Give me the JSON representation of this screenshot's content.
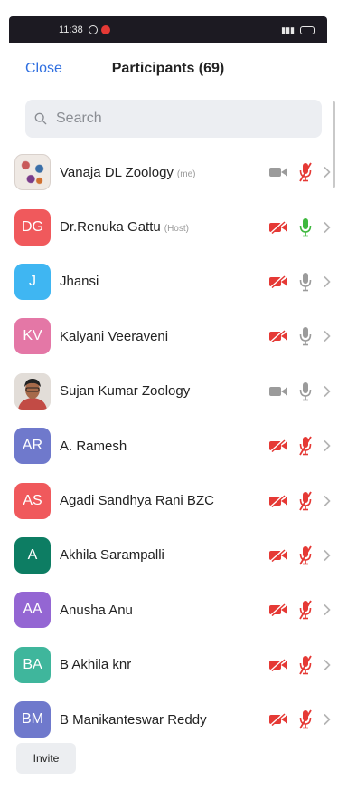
{
  "status_bar": {
    "time": "11:38"
  },
  "header": {
    "close_label": "Close",
    "title": "Participants (69)"
  },
  "search": {
    "placeholder": "Search"
  },
  "participants": [
    {
      "name": "Vanaja DL Zoology",
      "tag": "(me)",
      "avatar": {
        "type": "image",
        "icon": "art-photo"
      },
      "video": "off",
      "audio": "muted"
    },
    {
      "name": "Dr.Renuka Gattu",
      "tag": "(Host)",
      "avatar": {
        "type": "initials",
        "initials": "DG",
        "color": "#f0595c"
      },
      "video": "off-red",
      "audio": "active"
    },
    {
      "name": "Jhansi",
      "tag": "",
      "avatar": {
        "type": "initials",
        "initials": "J",
        "color": "#3fb6f2"
      },
      "video": "off-red",
      "audio": "unmuted"
    },
    {
      "name": "Kalyani Veeraveni",
      "tag": "",
      "avatar": {
        "type": "initials",
        "initials": "KV",
        "color": "#e477a6"
      },
      "video": "off-red",
      "audio": "unmuted"
    },
    {
      "name": "Sujan Kumar Zoology",
      "tag": "",
      "avatar": {
        "type": "image",
        "icon": "person-photo"
      },
      "video": "off",
      "audio": "unmuted"
    },
    {
      "name": "A. Ramesh",
      "tag": "",
      "avatar": {
        "type": "initials",
        "initials": "AR",
        "color": "#6f79cc"
      },
      "video": "off-red",
      "audio": "muted"
    },
    {
      "name": "Agadi Sandhya Rani BZC",
      "tag": "",
      "avatar": {
        "type": "initials",
        "initials": "AS",
        "color": "#f0595c"
      },
      "video": "off-red",
      "audio": "muted"
    },
    {
      "name": "Akhila Sarampalli",
      "tag": "",
      "avatar": {
        "type": "initials",
        "initials": "A",
        "color": "#0d7d63"
      },
      "video": "off-red",
      "audio": "muted"
    },
    {
      "name": "Anusha Anu",
      "tag": "",
      "avatar": {
        "type": "initials",
        "initials": "AA",
        "color": "#9466d3"
      },
      "video": "off-red",
      "audio": "muted"
    },
    {
      "name": "B Akhila knr",
      "tag": "",
      "avatar": {
        "type": "initials",
        "initials": "BA",
        "color": "#3fb69c"
      },
      "video": "off-red",
      "audio": "muted"
    },
    {
      "name": "B Manikanteswar Reddy",
      "tag": "",
      "avatar": {
        "type": "initials",
        "initials": "BM",
        "color": "#6f79cc"
      },
      "video": "off-red",
      "audio": "muted"
    }
  ],
  "footer": {
    "invite_label": "Invite"
  },
  "colors": {
    "accent": "#2f6fe0",
    "muted_red": "#e53935",
    "active_green": "#3db83d",
    "icon_gray": "#9b9b9b"
  }
}
